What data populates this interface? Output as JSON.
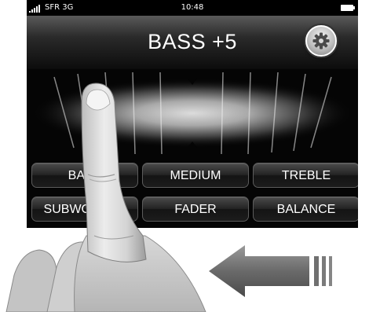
{
  "status_bar": {
    "carrier": "SFR 3G",
    "time": "10:48"
  },
  "header": {
    "title": "BASS +5",
    "settings_icon": "gear-icon"
  },
  "eq_buttons": [
    {
      "label": "BASS"
    },
    {
      "label": "MEDIUM"
    },
    {
      "label": "TREBLE"
    },
    {
      "label": "SUBWOOFER"
    },
    {
      "label": "FADER"
    },
    {
      "label": "BALANCE"
    }
  ],
  "overlay": {
    "hand": "pointing-hand-illustration",
    "arrow": "swipe-left-arrow-icon"
  }
}
